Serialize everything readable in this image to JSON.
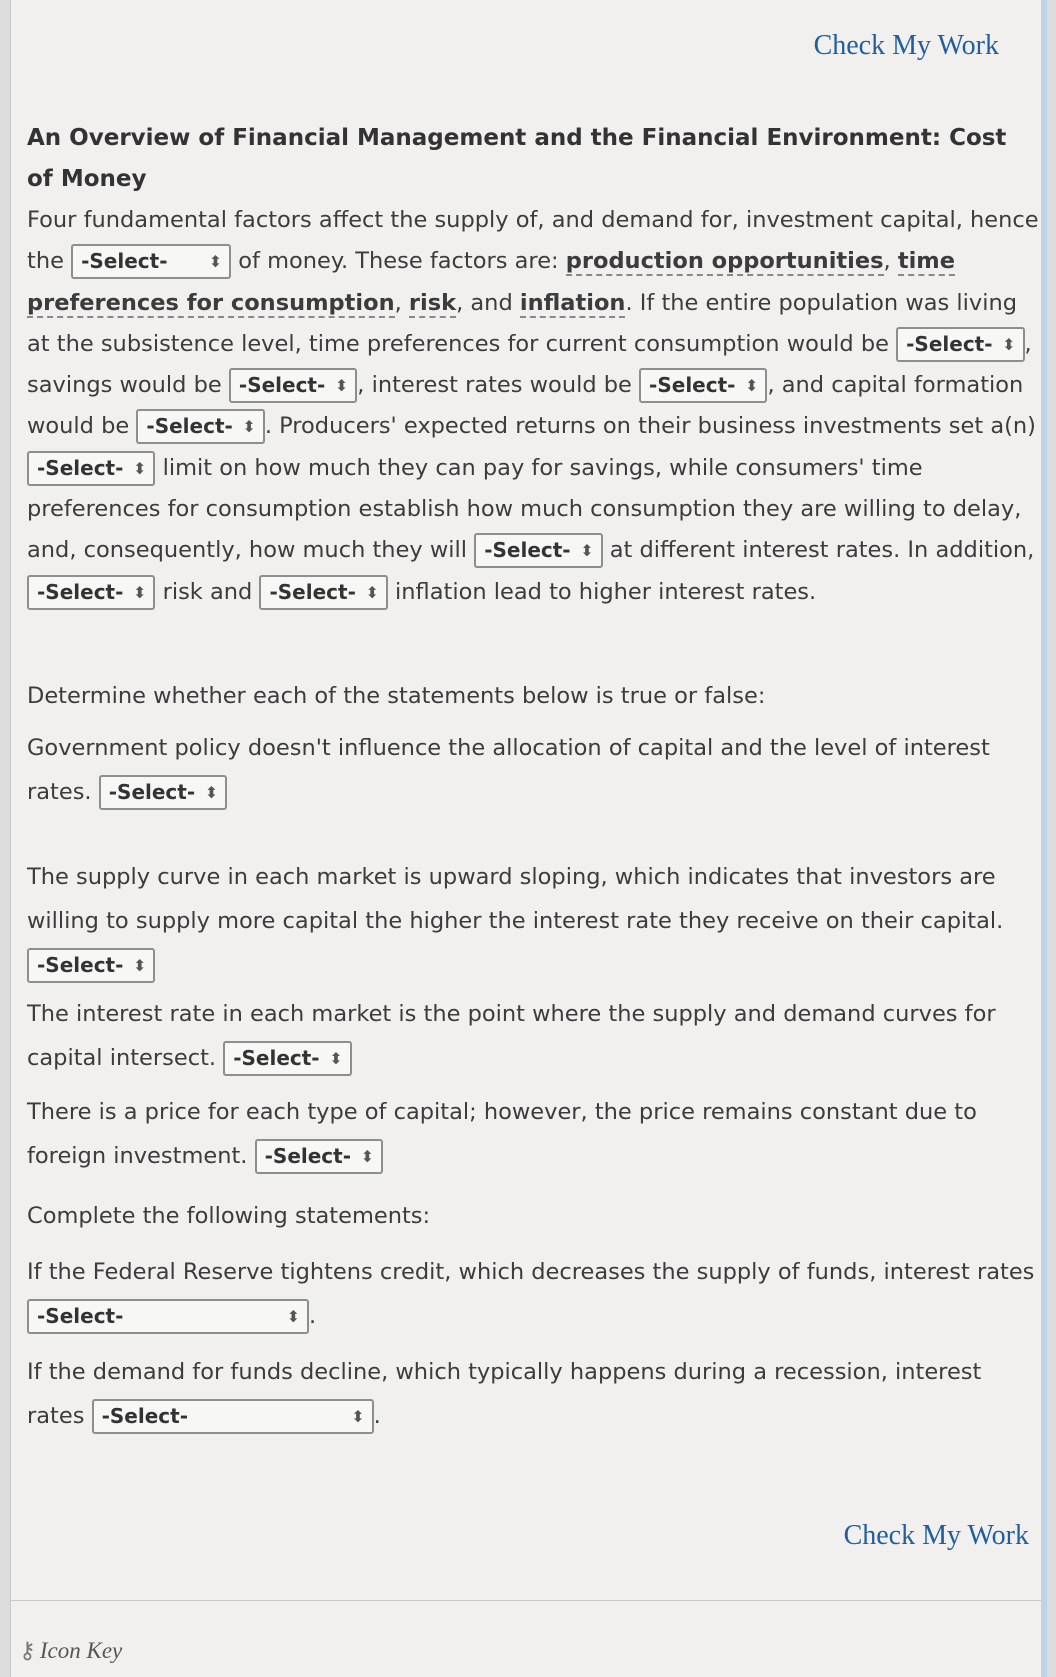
{
  "links": {
    "check_top": "Check My Work",
    "check_bottom": "Check My Work",
    "icon_key": "Icon Key"
  },
  "heading": "An Overview of Financial Management and the Financial Environment: Cost of Money",
  "select_label": "-Select-",
  "p1": {
    "t1": "Four fundamental factors affect the supply of, and demand for, investment capital, hence the",
    "t2": "of money. These factors are:",
    "term1": "production opportunities",
    "t3": ",",
    "term2": "time preferences for consumption",
    "t4": ",",
    "term3": "risk",
    "t5": ", and",
    "term4": "inflation",
    "t6": ". If the entire population was living at the subsistence level, time preferences for current consumption would be",
    "t7": ", savings would be",
    "t8": ", interest rates would be",
    "t9": ", and capital formation would be",
    "t10": ". Producers' expected returns on their business investments set a(n)",
    "t11": "limit on how much they can pay for savings, while consumers' time preferences for consumption establish how much consumption they are willing to delay, and, consequently, how much they will",
    "t12": "at different interest rates. In addition,",
    "t13": "risk and",
    "t14": "inflation lead to higher interest rates."
  },
  "tf_intro": "Determine whether each of the statements below is true or false:",
  "tf": [
    "Government policy doesn't influence the allocation of capital and the level of interest rates.",
    "The supply curve in each market is upward sloping, which indicates that investors are willing to supply more capital the higher the interest rate they receive on their capital.",
    "The interest rate in each market is the point where the supply and demand curves for capital intersect.",
    "There is a price for each type of capital; however, the price remains constant due to foreign investment."
  ],
  "complete_intro": "Complete the following statements:",
  "complete": [
    "If the Federal Reserve tightens credit, which decreases the supply of funds, interest rates",
    "If the demand for funds decline, which typically happens during a recession, interest rates"
  ],
  "period": "."
}
